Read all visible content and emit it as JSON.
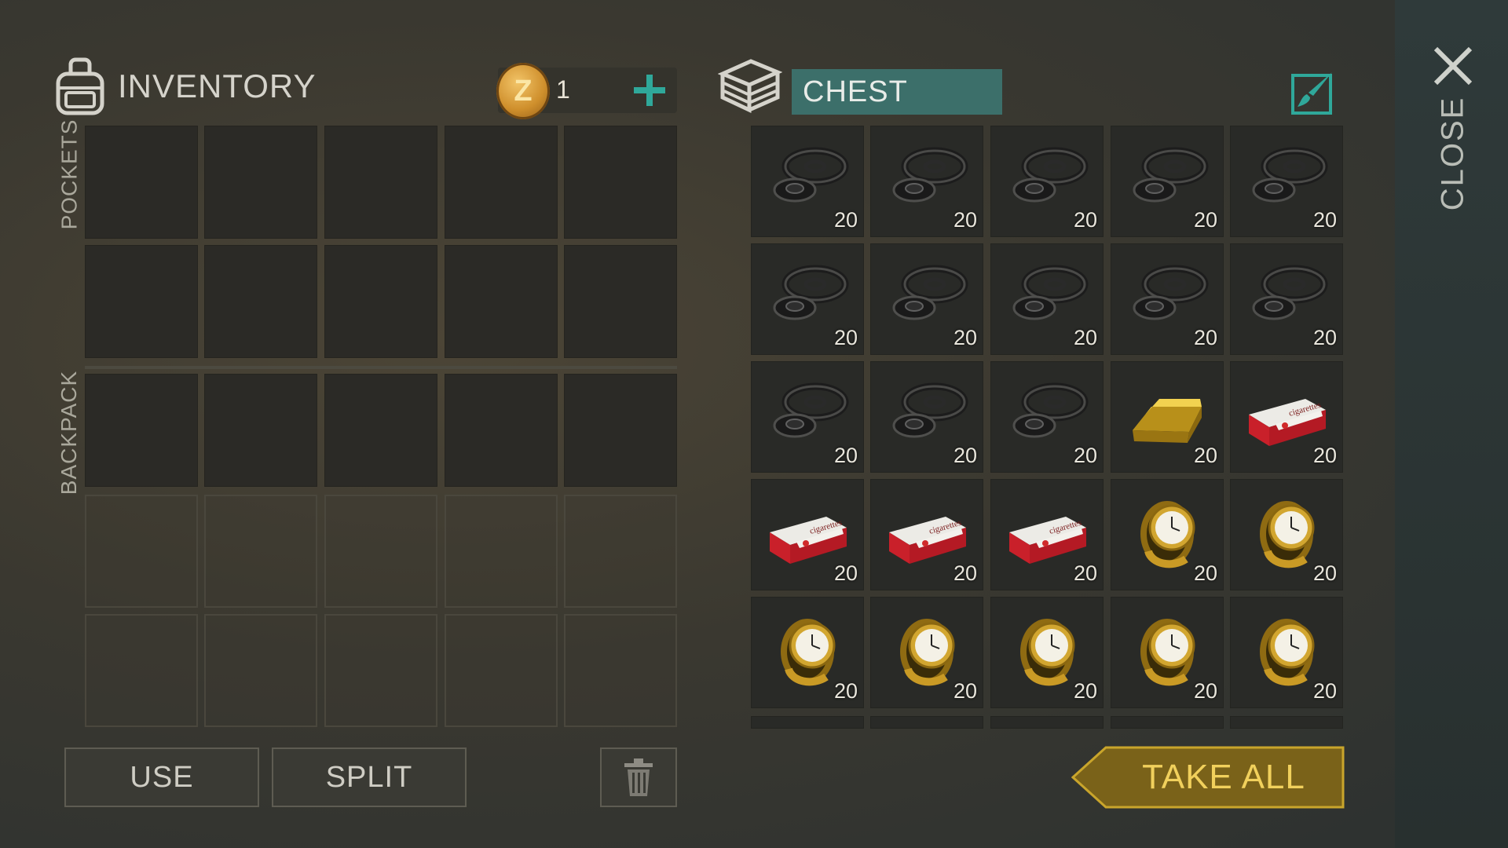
{
  "inventory": {
    "title": "INVENTORY",
    "pockets_label": "POCKETS",
    "backpack_label": "BACKPACK"
  },
  "currency": {
    "icon": "coin-icon",
    "coin_letter": "Z",
    "count": "1",
    "add_icon": "plus-icon"
  },
  "buttons": {
    "use": "USE",
    "split": "SPLIT",
    "delete_icon": "trash-icon"
  },
  "chest": {
    "title": "CHEST",
    "rows": [
      [
        {
          "item": "tire-icon",
          "qty": "20"
        },
        {
          "item": "tire-icon",
          "qty": "20"
        },
        {
          "item": "tire-icon",
          "qty": "20"
        },
        {
          "item": "tire-icon",
          "qty": "20"
        },
        {
          "item": "tire-icon",
          "qty": "20"
        }
      ],
      [
        {
          "item": "tire-icon",
          "qty": "20"
        },
        {
          "item": "tire-icon",
          "qty": "20"
        },
        {
          "item": "tire-icon",
          "qty": "20"
        },
        {
          "item": "tire-icon",
          "qty": "20"
        },
        {
          "item": "tire-icon",
          "qty": "20"
        }
      ],
      [
        {
          "item": "tire-icon",
          "qty": "20"
        },
        {
          "item": "tire-icon",
          "qty": "20"
        },
        {
          "item": "tire-icon",
          "qty": "20"
        },
        {
          "item": "gold-bar-icon",
          "qty": "20"
        },
        {
          "item": "cigarettes-icon",
          "qty": "20"
        }
      ],
      [
        {
          "item": "cigarettes-icon",
          "qty": "20"
        },
        {
          "item": "cigarettes-icon",
          "qty": "20"
        },
        {
          "item": "cigarettes-icon",
          "qty": "20"
        },
        {
          "item": "gold-watch-icon",
          "qty": "20"
        },
        {
          "item": "gold-watch-icon",
          "qty": "20"
        }
      ],
      [
        {
          "item": "gold-watch-icon",
          "qty": "20"
        },
        {
          "item": "gold-watch-icon",
          "qty": "20"
        },
        {
          "item": "gold-watch-icon",
          "qty": "20"
        },
        {
          "item": "gold-watch-icon",
          "qty": "20"
        },
        {
          "item": "gold-watch-icon",
          "qty": "20"
        }
      ]
    ],
    "take_all": "TAKE ALL",
    "edit_icon": "brush-edit-icon"
  },
  "close": {
    "label": "CLOSE",
    "icon": "close-icon"
  },
  "colors": {
    "accent_teal": "#3c6f6a",
    "take_all_gold": "#f1d05c",
    "plus_teal": "#2fa89a"
  }
}
